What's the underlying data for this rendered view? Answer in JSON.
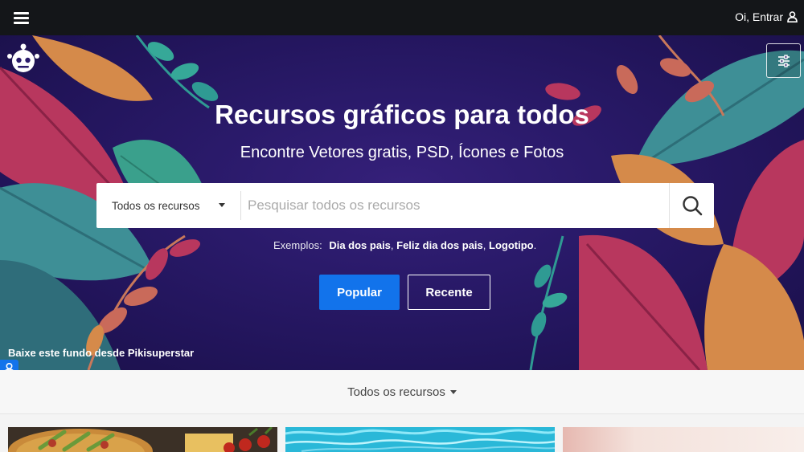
{
  "topbar": {
    "login_label": "Oi, Entrar"
  },
  "hero": {
    "title": "Recursos gráficos para todos",
    "subtitle": "Encontre Vetores gratis, PSD, Ícones e Fotos",
    "credit": "Baixe este fundo desde Pikisuperstar"
  },
  "search": {
    "category_selected": "Todos os recursos",
    "placeholder": "Pesquisar todos os recursos",
    "value": ""
  },
  "examples": {
    "label": "Exemplos:",
    "items": [
      "Dia dos pais",
      "Feliz dia dos pais",
      "Logotipo"
    ],
    "separator": ", ",
    "terminator": "."
  },
  "buttons": {
    "popular": "Popular",
    "recent": "Recente"
  },
  "filterbar": {
    "selected": "Todos os recursos"
  },
  "colors": {
    "accent": "#1273eb",
    "topbar": "#141619",
    "hero_bg": "#211459"
  },
  "icons": {
    "menu": "hamburger-icon",
    "user": "user-icon",
    "logo": "freepik-logo-icon",
    "filters": "sliders-icon",
    "search": "search-icon",
    "caret": "caret-down-icon",
    "author": "author-badge-icon"
  }
}
